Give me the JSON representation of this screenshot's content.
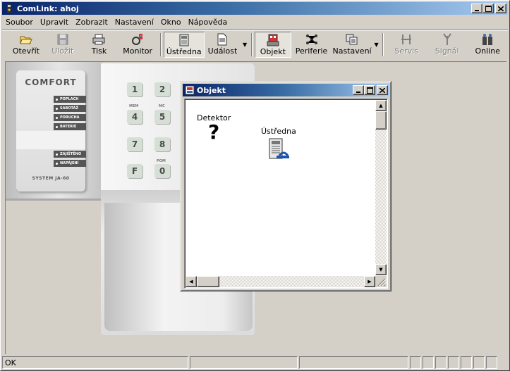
{
  "window": {
    "title": "ComLink: ahoj"
  },
  "menu": [
    "Soubor",
    "Upravit",
    "Zobrazit",
    "Nastavení",
    "Okno",
    "Nápověda"
  ],
  "toolbar": {
    "open": "Otevřít",
    "save": "Uložit",
    "print": "Tisk",
    "monitor": "Monitor",
    "ustredna": "Ústředna",
    "udalost": "Událost",
    "objekt": "Objekt",
    "periferie": "Periferie",
    "nastaveni": "Nastavení",
    "servis": "Servis",
    "signal": "Signál",
    "online": "Online"
  },
  "keypad": {
    "brand": "COMFORT",
    "indicators": [
      "POPLACH",
      "SABOTÁŽ",
      "PORUCHA",
      "BATERIE",
      "ZAJIŠTĚNO",
      "NAPÁJENÍ"
    ],
    "model": "SYSTEM JA-60",
    "keys": [
      "1",
      "2",
      "4",
      "5",
      "7",
      "8",
      "F",
      "0"
    ],
    "sublabels": [
      "MEM",
      "MC",
      "POM"
    ]
  },
  "child": {
    "title": "Objekt",
    "items": [
      {
        "label": "Detektor",
        "icon": "question-mark-icon"
      },
      {
        "label": "Ústředna",
        "icon": "control-panel-icon"
      }
    ]
  },
  "status": {
    "text": "OK"
  },
  "colors": {
    "titlebar_start": "#0a246a",
    "titlebar_end": "#a6caf0",
    "face": "#d4d0c8"
  }
}
